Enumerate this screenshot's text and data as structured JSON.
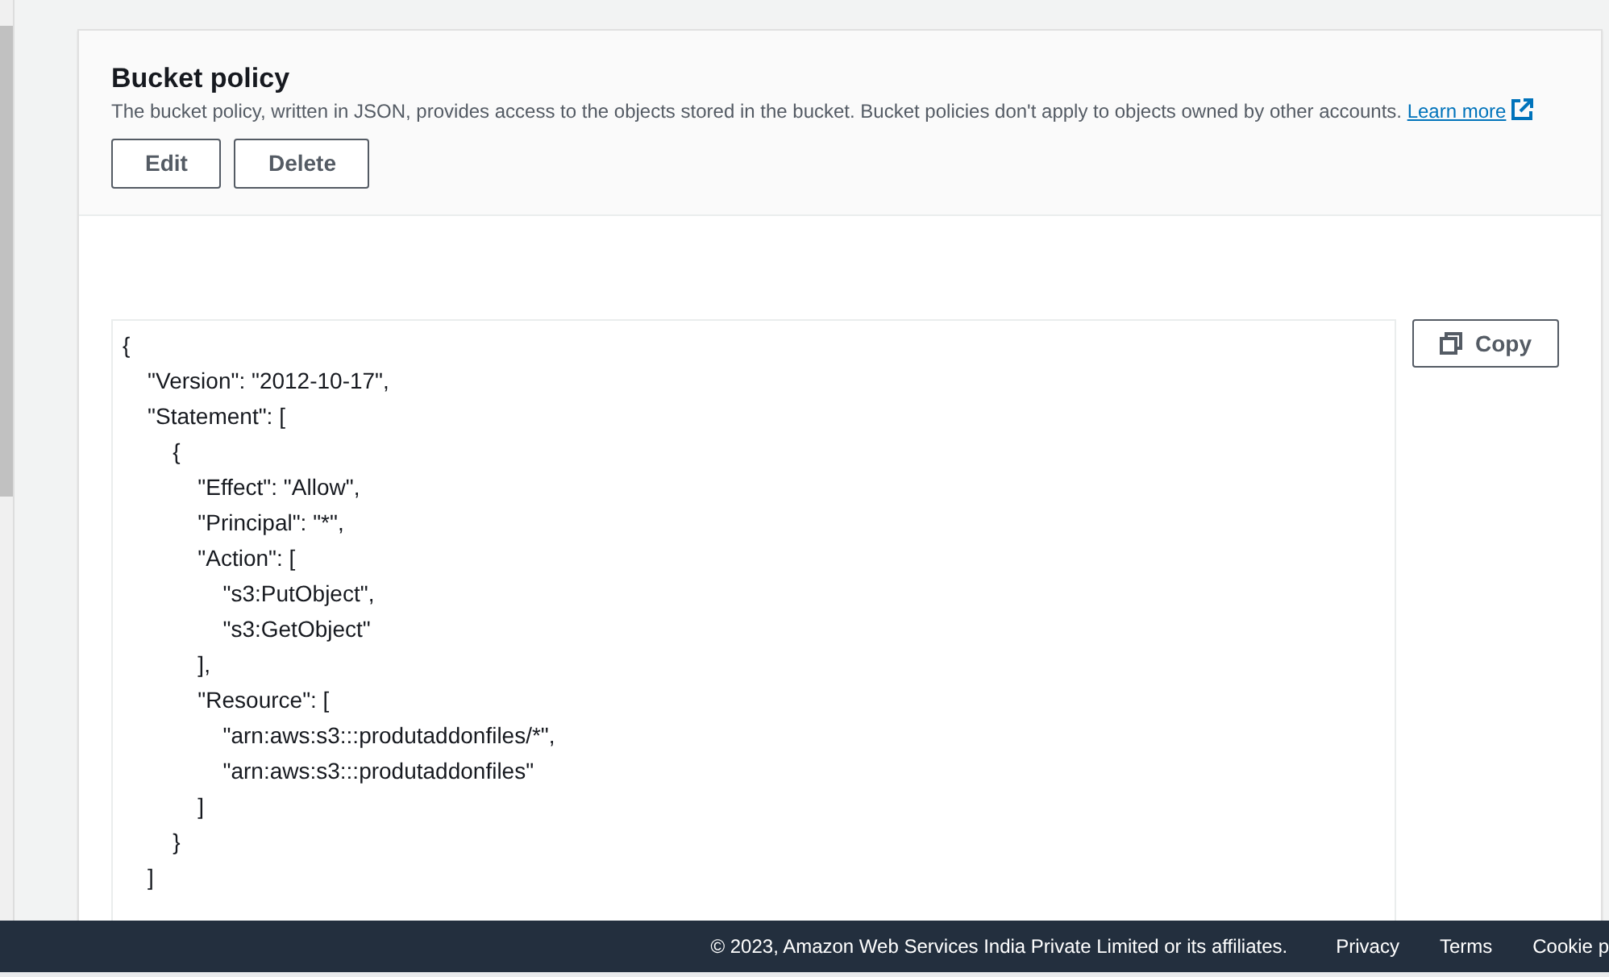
{
  "panel": {
    "title": "Bucket policy",
    "description": "The bucket policy, written in JSON, provides access to the objects stored in the bucket. Bucket policies don't apply to objects owned by other accounts.",
    "link": "Learn more",
    "buttons": [
      "Edit",
      "Delete"
    ]
  },
  "policy": {
    "lines": [
      "{",
      "    \"Version\": \"2012-10-17\",",
      "    \"Statement\": [",
      "        {",
      "            \"Effect\": \"Allow\",",
      "            \"Principal\": \"*\",",
      "            \"Action\": [",
      "                \"s3:PutObject\",",
      "                \"s3:GetObject\"",
      "            ],",
      "            \"Resource\": [",
      "                \"arn:aws:s3:::produtaddonfiles/*\",",
      "                \"arn:aws:s3:::produtaddonfiles\"",
      "            ]",
      "        }",
      "    ]"
    ],
    "copy_button": "Copy"
  },
  "footer": {
    "copyright": "© 2023, Amazon Web Services India Private Limited or its affiliates.",
    "links": [
      "Privacy",
      "Terms",
      "Cookie p"
    ]
  }
}
